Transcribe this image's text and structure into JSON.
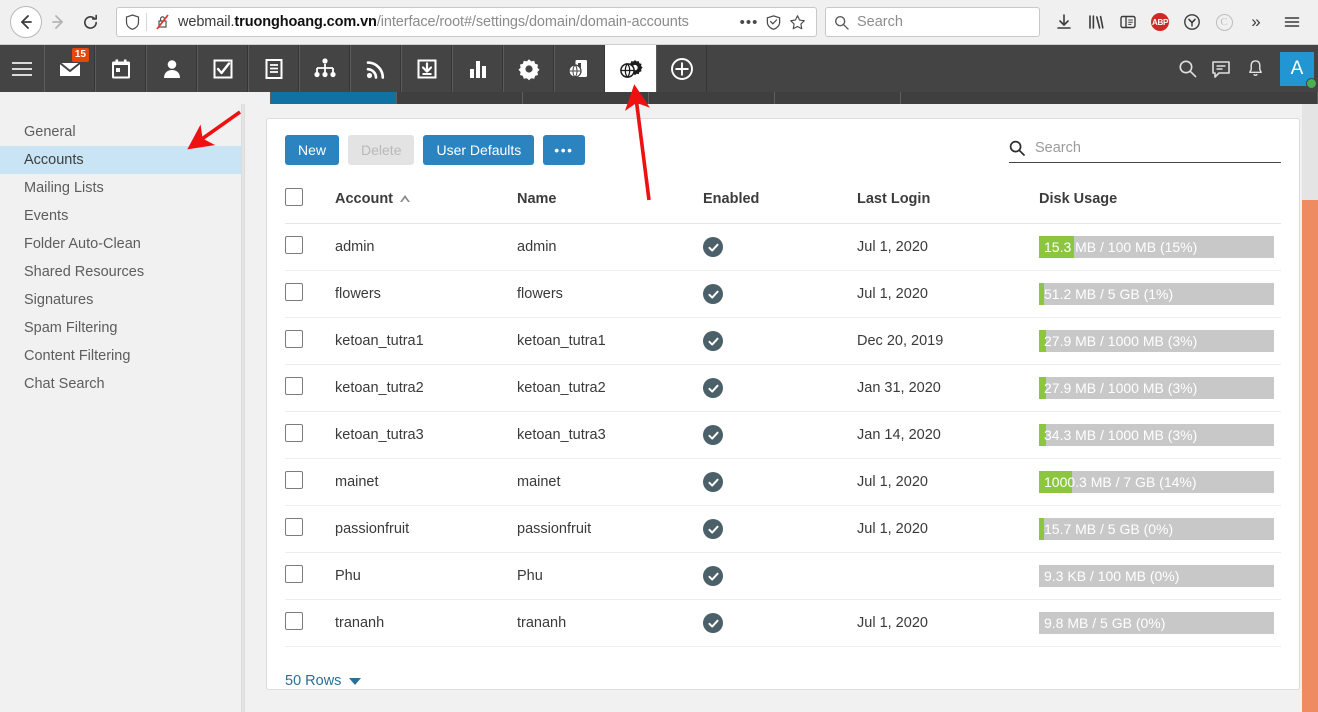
{
  "browser": {
    "url_prefix": "webmail.",
    "url_host_strong": "truonghoang.com.vn",
    "url_path": "/interface/root#/settings/domain/domain-accounts",
    "url_dots": "•••",
    "search_placeholder": "Search",
    "icons": {
      "back": "back-arrow-icon",
      "forward": "forward-arrow-icon",
      "reload": "reload-icon",
      "shield": "shield-icon",
      "no_lock": "no-lock-icon",
      "pocket": "pocket-shield-icon",
      "bookmark": "star-icon",
      "downloads": "download-icon",
      "library": "library-icon",
      "sidebar": "sidebar-icon",
      "adblock": "ABP",
      "pocket_save": "pocket-icon",
      "container": "C",
      "overflow": "»",
      "menu": "hamburger-menu-icon"
    }
  },
  "app_nav": {
    "hamburger": "hamburger-icon",
    "tabs": [
      {
        "name": "mail",
        "icon": "envelope-icon",
        "badge": "15",
        "active": false
      },
      {
        "name": "calendar",
        "icon": "calendar-icon",
        "badge": "",
        "active": false
      },
      {
        "name": "contacts",
        "icon": "person-icon",
        "badge": "",
        "active": false
      },
      {
        "name": "tasks",
        "icon": "checkbox-task-icon",
        "badge": "",
        "active": false
      },
      {
        "name": "notes",
        "icon": "notes-icon",
        "badge": "",
        "active": false
      },
      {
        "name": "sitemap",
        "icon": "org-chart-icon",
        "badge": "",
        "active": false
      },
      {
        "name": "feeds",
        "icon": "rss-icon",
        "badge": "",
        "active": false
      },
      {
        "name": "archive",
        "icon": "inbox-download-icon",
        "badge": "",
        "active": false
      },
      {
        "name": "reports",
        "icon": "bar-chart-icon",
        "badge": "",
        "active": false
      },
      {
        "name": "settings",
        "icon": "gear-icon",
        "badge": "",
        "active": false
      },
      {
        "name": "domain",
        "icon": "globe-panel-icon",
        "badge": "",
        "active": false
      },
      {
        "name": "domain-settings",
        "icon": "globe-gear-icon",
        "badge": "",
        "active": true
      },
      {
        "name": "add",
        "icon": "plus-circle-icon",
        "badge": "",
        "active": false
      }
    ],
    "right_icons": [
      {
        "name": "search",
        "icon": "magnifier-icon"
      },
      {
        "name": "chat",
        "icon": "chat-bubble-icon"
      },
      {
        "name": "notifications",
        "icon": "bell-icon"
      }
    ],
    "avatar_letter": "A",
    "avatar_status": "online"
  },
  "sidebar": {
    "items": [
      {
        "label": "General",
        "active": false
      },
      {
        "label": "Accounts",
        "active": true
      },
      {
        "label": "Mailing Lists",
        "active": false
      },
      {
        "label": "Events",
        "active": false
      },
      {
        "label": "Folder Auto-Clean",
        "active": false
      },
      {
        "label": "Shared Resources",
        "active": false
      },
      {
        "label": "Signatures",
        "active": false
      },
      {
        "label": "Spam Filtering",
        "active": false
      },
      {
        "label": "Content Filtering",
        "active": false
      },
      {
        "label": "Chat Search",
        "active": false
      }
    ]
  },
  "toolbar": {
    "new_label": "New",
    "delete_label": "Delete",
    "user_defaults_label": "User Defaults",
    "more_label": "•••",
    "search_placeholder": "Search",
    "search_value": ""
  },
  "table": {
    "columns": [
      "Account",
      "Name",
      "Enabled",
      "Last Login",
      "Disk Usage"
    ],
    "sort_column": "Account",
    "sort_direction": "asc",
    "rows": [
      {
        "account": "admin",
        "name": "admin",
        "enabled": true,
        "last_login": "Jul 1, 2020",
        "disk_label": "15.3 MB / 100 MB (15%)",
        "disk_pct": 15
      },
      {
        "account": "flowers",
        "name": "flowers",
        "enabled": true,
        "last_login": "Jul 1, 2020",
        "disk_label": "51.2 MB / 5 GB (1%)",
        "disk_pct": 1
      },
      {
        "account": "ketoan_tutra1",
        "name": "ketoan_tutra1",
        "enabled": true,
        "last_login": "Dec 20, 2019",
        "disk_label": "27.9 MB / 1000 MB (3%)",
        "disk_pct": 3
      },
      {
        "account": "ketoan_tutra2",
        "name": "ketoan_tutra2",
        "enabled": true,
        "last_login": "Jan 31, 2020",
        "disk_label": "27.9 MB / 1000 MB (3%)",
        "disk_pct": 3
      },
      {
        "account": "ketoan_tutra3",
        "name": "ketoan_tutra3",
        "enabled": true,
        "last_login": "Jan 14, 2020",
        "disk_label": "34.3 MB / 1000 MB (3%)",
        "disk_pct": 3
      },
      {
        "account": "mainet",
        "name": "mainet",
        "enabled": true,
        "last_login": "Jul 1, 2020",
        "disk_label": "1000.3 MB / 7 GB (14%)",
        "disk_pct": 14
      },
      {
        "account": "passionfruit",
        "name": "passionfruit",
        "enabled": true,
        "last_login": "Jul 1, 2020",
        "disk_label": "15.7 MB / 5 GB (0%)",
        "disk_pct": 0.6
      },
      {
        "account": "Phu",
        "name": "Phu",
        "enabled": true,
        "last_login": "",
        "disk_label": "9.3 KB / 100 MB (0%)",
        "disk_pct": 0
      },
      {
        "account": "trananh",
        "name": "trananh",
        "enabled": true,
        "last_login": "Jul 1, 2020",
        "disk_label": "9.8 MB / 5 GB (0%)",
        "disk_pct": 0
      }
    ]
  },
  "footer": {
    "rows_label": "50 Rows"
  },
  "colors": {
    "accent_blue": "#2b83c0",
    "nav_dark": "#444444",
    "sidebar_active": "#c9e5f5",
    "bar_fill_green": "#8cc63e",
    "bar_track_gray": "#c8c8c8",
    "enabled_check": "#4c6069",
    "link_blue": "#2b6f96",
    "annotation_red": "#ee1111",
    "scrollbar_thumb": "#ef8b63",
    "avatar_blue": "#2196d3",
    "badge_orange": "#e8470a",
    "subtab_blue": "#0f72a3"
  }
}
